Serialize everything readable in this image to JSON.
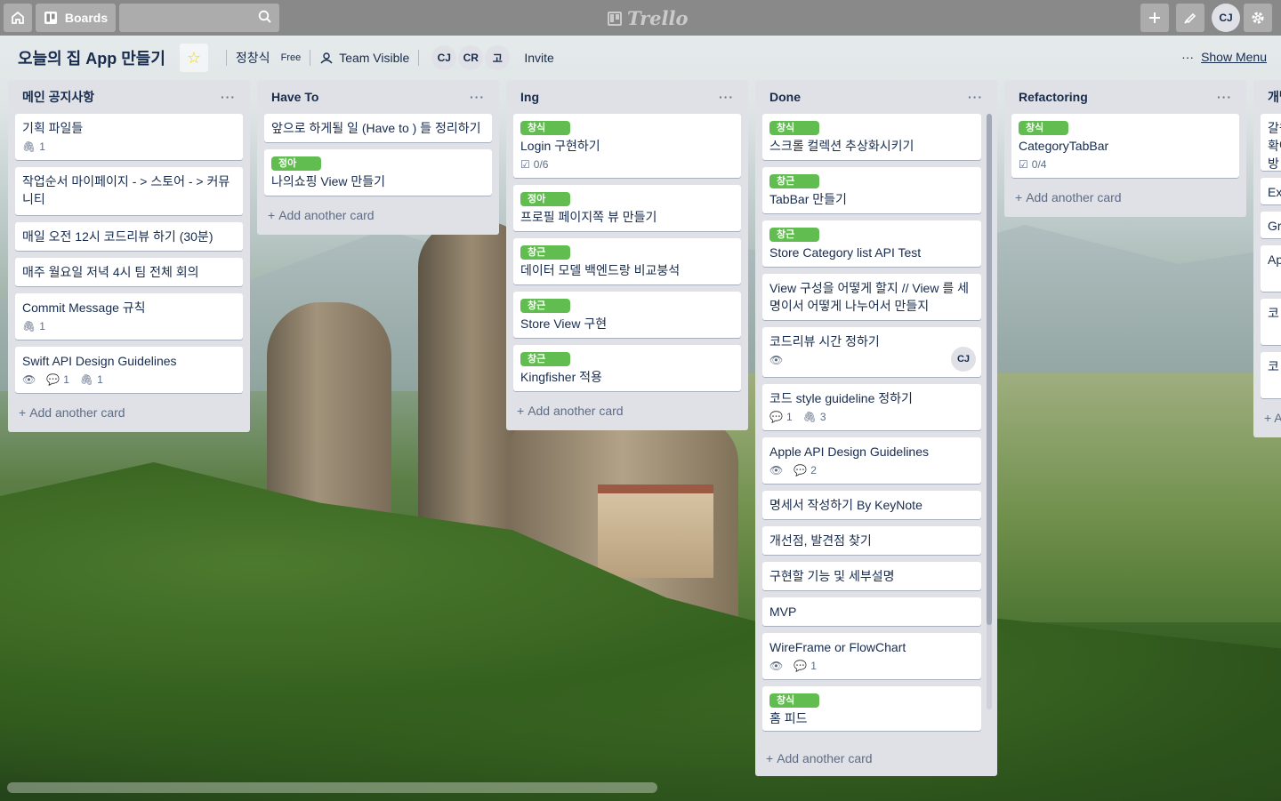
{
  "header": {
    "home_icon": "home-icon",
    "boards_label": "Boards",
    "search_placeholder": "",
    "logo": "Trello",
    "user_initials": "CJ"
  },
  "board": {
    "title": "오늘의 집 App 만들기",
    "team": "정창식",
    "plan": "Free",
    "visibility": "Team Visible",
    "members": [
      "CJ",
      "CR",
      "고"
    ],
    "invite": "Invite",
    "show_menu": "Show Menu",
    "star_color": "#f2d600"
  },
  "lists": [
    {
      "name": "메인 공지사항",
      "cards": [
        {
          "title": "기획 파일들",
          "attachments": "1"
        },
        {
          "title": "작업순서 마이페이지 - > 스토어 - > 커뮤니티"
        },
        {
          "title": "매일 오전 12시 코드리뷰 하기 (30분)"
        },
        {
          "title": "매주 월요일 저녁 4시 팀 전체 회의"
        },
        {
          "title": "Commit Message 규칙",
          "attachments": "1"
        },
        {
          "title": "Swift API Design Guidelines",
          "comments": "1",
          "attachments": "1"
        }
      ],
      "add": "Add another card"
    },
    {
      "name": "Have To",
      "cards": [
        {
          "title": "앞으로 하게될 일 (Have to ) 들 정리하기"
        },
        {
          "label": "정아",
          "title": "나의쇼핑 View 만들기"
        }
      ],
      "add": "Add another card"
    },
    {
      "name": "Ing",
      "cards": [
        {
          "label": "창식",
          "title": "Login 구현하기",
          "checklist": "0/6"
        },
        {
          "label": "정아",
          "title": "프로필 페이지쪽 뷰 만들기"
        },
        {
          "label": "창근",
          "title": "데이터 모델 백엔드랑 비교붕석"
        },
        {
          "label": "창근",
          "title": "Store View 구현"
        },
        {
          "label": "창근",
          "title": "Kingfisher 적용"
        }
      ],
      "add": "Add another card"
    },
    {
      "name": "Done",
      "cards": [
        {
          "label": "창식",
          "title": "스크롤 컬렉션 추상화시키기"
        },
        {
          "label": "창근",
          "title": "TabBar 만들기"
        },
        {
          "label": "창근",
          "title": "Store Category list API Test"
        },
        {
          "title": "View 구성을 어떻게 할지 // View 를 세명이서 어떻게 나누어서 만들지"
        },
        {
          "title": "코드리뷰 시간 정하기",
          "member": "CJ"
        },
        {
          "title": "코드 style guideline 정하기",
          "comments": "1",
          "attachments": "3"
        },
        {
          "title": "Apple API Design Guidelines",
          "comments": "2"
        },
        {
          "title": "명세서 작성하기 By KeyNote"
        },
        {
          "title": "개선점, 발견점 찾기"
        },
        {
          "title": "구현할 기능 및 세부설명"
        },
        {
          "title": "MVP"
        },
        {
          "title": "WireFrame or FlowChart",
          "comments": "1"
        },
        {
          "label": "창식",
          "title": "홈 피드"
        }
      ],
      "add": "Add another card"
    },
    {
      "name": "Refactoring",
      "cards": [
        {
          "label": "창식",
          "title": "CategoryTabBar",
          "checklist": "0/4"
        }
      ],
      "add": "Add another card"
    },
    {
      "name": "개발",
      "cards": [
        {
          "title": "갈원\n확여\n방"
        },
        {
          "title": "Ex"
        },
        {
          "title": "Gr"
        },
        {
          "title": "Ap"
        },
        {
          "title": "코"
        },
        {
          "title": "코"
        }
      ],
      "add": "+ A"
    }
  ],
  "colors": {
    "label_green": "#61bd4f",
    "list_bg": "#dfe1e6",
    "header_bg": "#787878"
  }
}
